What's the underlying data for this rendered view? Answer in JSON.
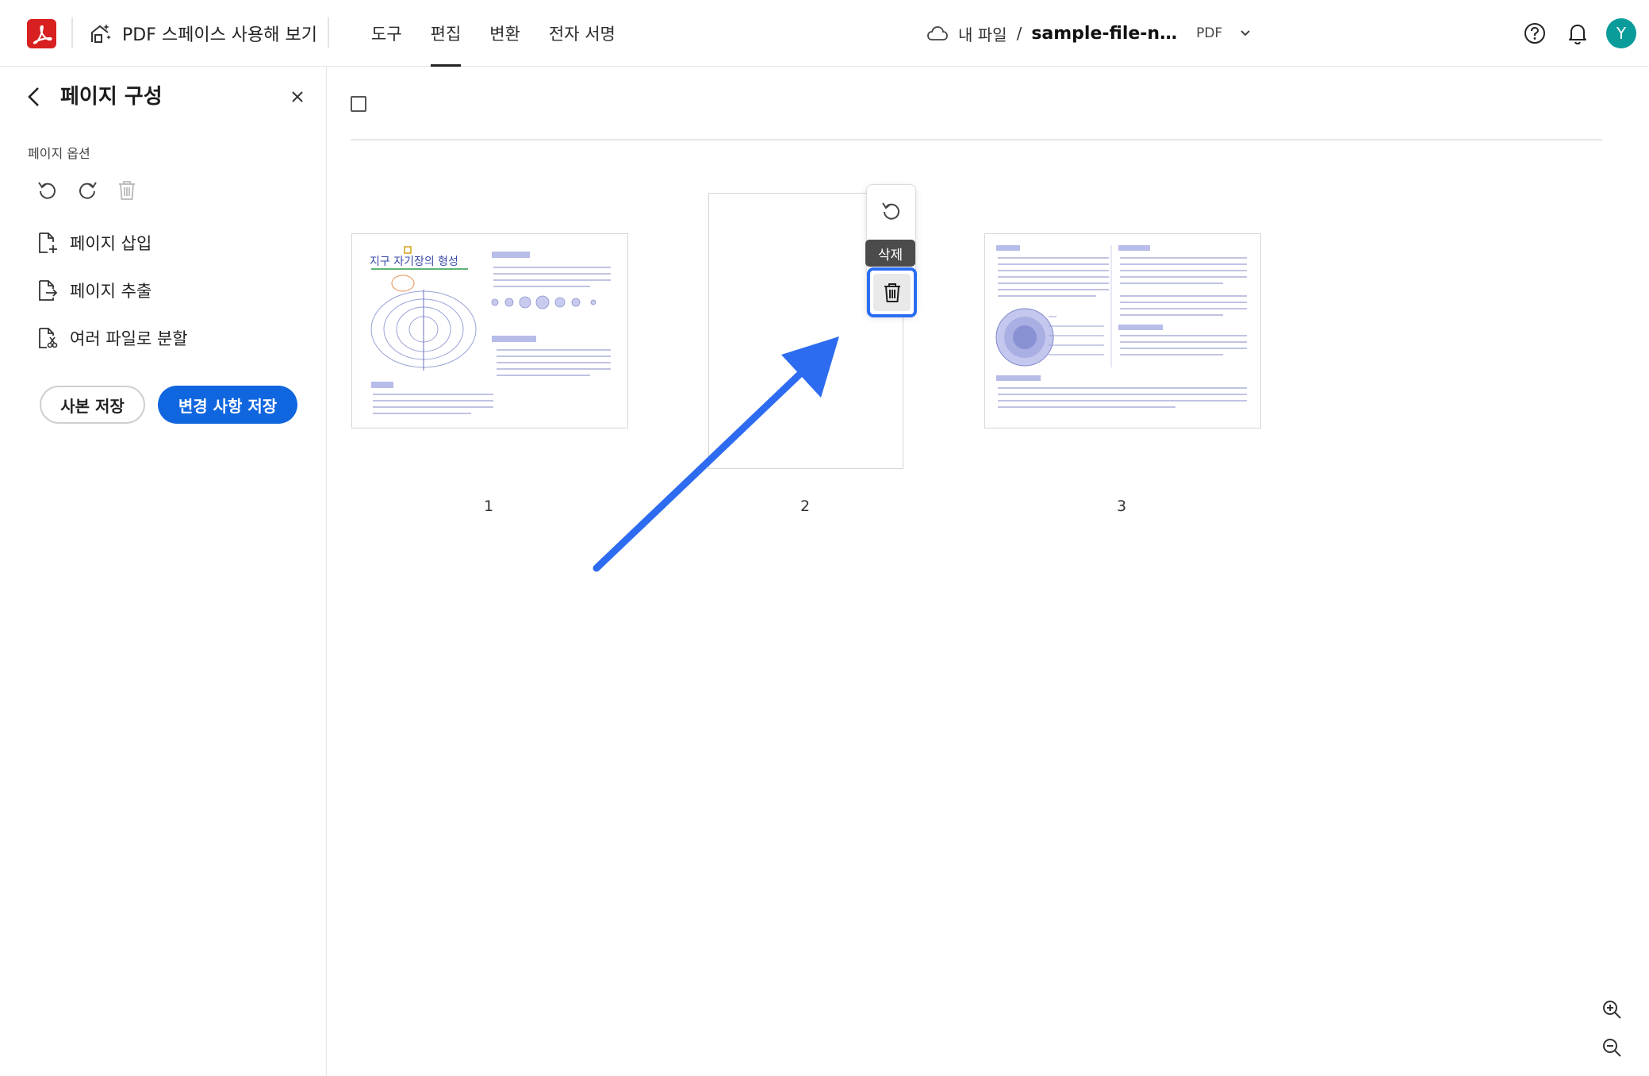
{
  "header": {
    "try_spaces_label": "PDF 스페이스 사용해 보기",
    "nav": [
      {
        "label": "도구",
        "active": false
      },
      {
        "label": "편집",
        "active": true
      },
      {
        "label": "변환",
        "active": false
      },
      {
        "label": "전자 서명",
        "active": false
      }
    ],
    "breadcrumb": {
      "root": "내 파일",
      "separator": "/",
      "filename": "sample-file-n…",
      "filetype": "PDF"
    },
    "avatar_initial": "Y"
  },
  "sidebar": {
    "title": "페이지 구성",
    "section_label": "페이지 옵션",
    "actions": [
      {
        "label": "페이지 삽입"
      },
      {
        "label": "페이지 추출"
      },
      {
        "label": "여러 파일로 분할"
      }
    ],
    "save_copy_label": "사본 저장",
    "save_changes_label": "변경 사항 저장"
  },
  "pages": [
    {
      "number": "1",
      "heading": "지구 자기장의 형성"
    },
    {
      "number": "2",
      "heading": ""
    },
    {
      "number": "3",
      "heading": ""
    }
  ],
  "page_toolbar": {
    "tooltip": "삭제"
  },
  "colors": {
    "accent": "#1066df",
    "focus": "#2b6ef2",
    "arrow": "#2d6cf0",
    "logo": "#d7201f",
    "avatar": "#0a9b9b"
  }
}
